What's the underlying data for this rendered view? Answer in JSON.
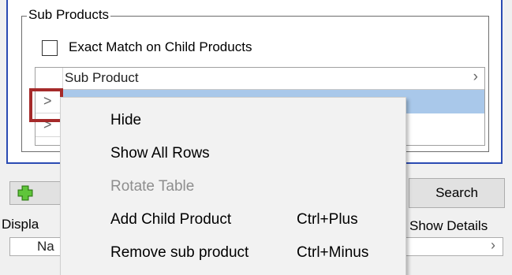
{
  "group": {
    "title": "Sub Products",
    "exact_match_label": "Exact Match on Child Products",
    "exact_match_checked": false
  },
  "grid": {
    "column_header": "Sub Product",
    "header_chevron": "›",
    "row_chevron": ">",
    "rows": [
      {
        "selected": true,
        "value": ""
      },
      {
        "selected": false,
        "value": ""
      }
    ]
  },
  "toolbar": {
    "search_label": "Search",
    "display_label": "Displa",
    "show_details_label": "Show Details",
    "field_text": "Na",
    "field_chevron": "›"
  },
  "context_menu": {
    "items": [
      {
        "label": "Hide",
        "shortcut": "",
        "enabled": true
      },
      {
        "label": "Show All Rows",
        "shortcut": "",
        "enabled": true
      },
      {
        "label": "Rotate Table",
        "shortcut": "",
        "enabled": false
      },
      {
        "label": "Add Child Product",
        "shortcut": "Ctrl+Plus",
        "enabled": true
      },
      {
        "label": "Remove sub product",
        "shortcut": "Ctrl+Minus",
        "enabled": true
      }
    ]
  },
  "colors": {
    "outer_panel_border": "#2b4bb3",
    "selected_row": "#a9c8ea",
    "highlight_box": "#a52a2a",
    "menu_background": "#f2f2f2",
    "disabled_text": "#8e8e8e",
    "add_icon": "#4caf2a"
  },
  "icons": {
    "add": "plus-icon",
    "search": "",
    "expand": "chevron-right-icon"
  }
}
